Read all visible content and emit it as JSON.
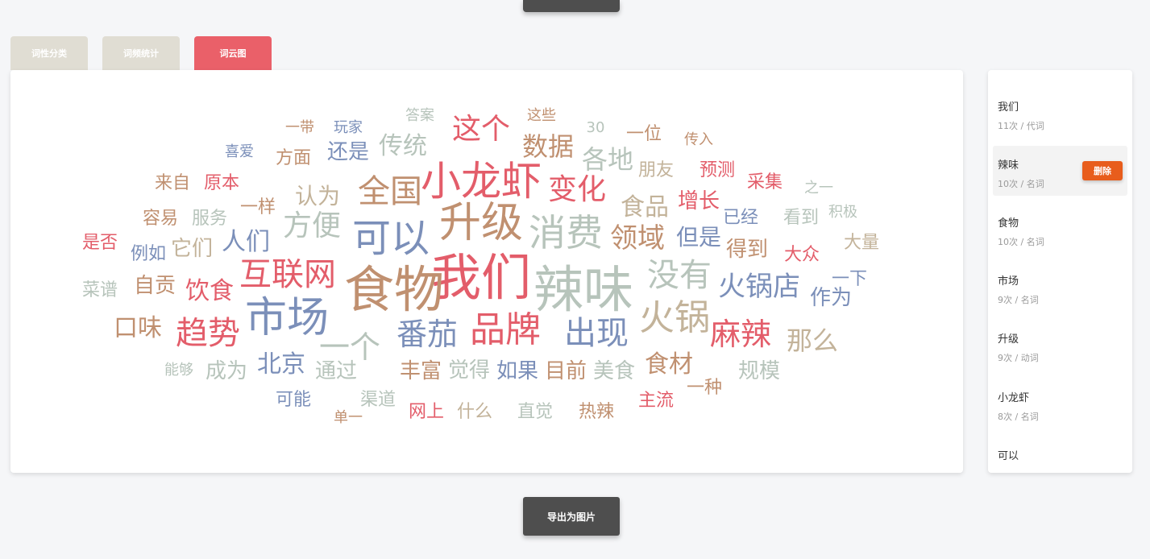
{
  "tabs": [
    {
      "label": "词性分类",
      "active": false
    },
    {
      "label": "词频统计",
      "active": false
    },
    {
      "label": "词云图",
      "active": true
    }
  ],
  "colors": {
    "red": "#e35d6a",
    "brown": "#c09070",
    "blue": "#7b8fb9",
    "sage": "#b7c4bb",
    "tan": "#c3b39a"
  },
  "cloud_words": [
    {
      "text": "我们",
      "size": 62,
      "color": "#e35d6a"
    },
    {
      "text": "食物",
      "size": 62,
      "color": "#c09070"
    },
    {
      "text": "辣味",
      "size": 62,
      "color": "#b7c4bb"
    },
    {
      "text": "升级",
      "size": 52,
      "color": "#c09070"
    },
    {
      "text": "市场",
      "size": 52,
      "color": "#7b8fb9"
    },
    {
      "text": "小龙虾",
      "size": 50,
      "color": "#e35d6a"
    },
    {
      "text": "可以",
      "size": 48,
      "color": "#7b8fb9"
    },
    {
      "text": "消费",
      "size": 46,
      "color": "#b7c4bb"
    },
    {
      "text": "品牌",
      "size": 44,
      "color": "#e35d6a"
    },
    {
      "text": "火锅",
      "size": 44,
      "color": "#c3b39a"
    },
    {
      "text": "没有",
      "size": 40,
      "color": "#b7c4bb"
    },
    {
      "text": "出现",
      "size": 40,
      "color": "#7b8fb9"
    },
    {
      "text": "全国",
      "size": 40,
      "color": "#c09070"
    },
    {
      "text": "互联网",
      "size": 40,
      "color": "#e35d6a"
    },
    {
      "text": "趋势",
      "size": 40,
      "color": "#e35d6a"
    },
    {
      "text": "番茄",
      "size": 38,
      "color": "#7b8fb9"
    },
    {
      "text": "麻辣",
      "size": 38,
      "color": "#e35d6a"
    },
    {
      "text": "一个",
      "size": 38,
      "color": "#b7c4bb"
    },
    {
      "text": "方便",
      "size": 36,
      "color": "#b7c4bb"
    },
    {
      "text": "变化",
      "size": 36,
      "color": "#e35d6a"
    },
    {
      "text": "这个",
      "size": 36,
      "color": "#e35d6a"
    },
    {
      "text": "火锅店",
      "size": 34,
      "color": "#7b8fb9"
    },
    {
      "text": "领域",
      "size": 34,
      "color": "#c09070"
    },
    {
      "text": "那么",
      "size": 32,
      "color": "#c3b39a"
    },
    {
      "text": "数据",
      "size": 32,
      "color": "#c09070"
    },
    {
      "text": "各地",
      "size": 32,
      "color": "#b7c4bb"
    },
    {
      "text": "人们",
      "size": 30,
      "color": "#7b8fb9"
    },
    {
      "text": "食品",
      "size": 30,
      "color": "#c3b39a"
    },
    {
      "text": "传统",
      "size": 30,
      "color": "#b7c4bb"
    },
    {
      "text": "食材",
      "size": 30,
      "color": "#c09070"
    },
    {
      "text": "饮食",
      "size": 30,
      "color": "#e35d6a"
    },
    {
      "text": "北京",
      "size": 30,
      "color": "#7b8fb9"
    },
    {
      "text": "口味",
      "size": 30,
      "color": "#c09070"
    },
    {
      "text": "认为",
      "size": 28,
      "color": "#c3b39a"
    },
    {
      "text": "但是",
      "size": 28,
      "color": "#7b8fb9"
    },
    {
      "text": "还是",
      "size": 26,
      "color": "#7b8fb9"
    },
    {
      "text": "增长",
      "size": 26,
      "color": "#e35d6a"
    },
    {
      "text": "它们",
      "size": 26,
      "color": "#c3b39a"
    },
    {
      "text": "作为",
      "size": 26,
      "color": "#7b8fb9"
    },
    {
      "text": "成为",
      "size": 26,
      "color": "#b7c4bb"
    },
    {
      "text": "通过",
      "size": 26,
      "color": "#b7c4bb"
    },
    {
      "text": "丰富",
      "size": 26,
      "color": "#c09070"
    },
    {
      "text": "觉得",
      "size": 26,
      "color": "#b7c4bb"
    },
    {
      "text": "如果",
      "size": 26,
      "color": "#7b8fb9"
    },
    {
      "text": "目前",
      "size": 26,
      "color": "#c09070"
    },
    {
      "text": "美食",
      "size": 26,
      "color": "#b7c4bb"
    },
    {
      "text": "规模",
      "size": 26,
      "color": "#b7c4bb"
    },
    {
      "text": "得到",
      "size": 26,
      "color": "#c09070"
    },
    {
      "text": "自贡",
      "size": 26,
      "color": "#c09070"
    },
    {
      "text": "大量",
      "size": 22,
      "color": "#c3b39a"
    },
    {
      "text": "大众",
      "size": 22,
      "color": "#e35d6a"
    },
    {
      "text": "预测",
      "size": 22,
      "color": "#e35d6a"
    },
    {
      "text": "采集",
      "size": 22,
      "color": "#e35d6a"
    },
    {
      "text": "朋友",
      "size": 22,
      "color": "#c3b39a"
    },
    {
      "text": "一位",
      "size": 22,
      "color": "#c09070"
    },
    {
      "text": "原本",
      "size": 22,
      "color": "#e35d6a"
    },
    {
      "text": "来自",
      "size": 22,
      "color": "#c09070"
    },
    {
      "text": "方面",
      "size": 22,
      "color": "#c09070"
    },
    {
      "text": "一样",
      "size": 22,
      "color": "#c09070"
    },
    {
      "text": "服务",
      "size": 22,
      "color": "#b7c4bb"
    },
    {
      "text": "容易",
      "size": 22,
      "color": "#c09070"
    },
    {
      "text": "例如",
      "size": 22,
      "color": "#7b8fb9"
    },
    {
      "text": "是否",
      "size": 22,
      "color": "#e35d6a"
    },
    {
      "text": "菜谱",
      "size": 22,
      "color": "#b7c4bb"
    },
    {
      "text": "一下",
      "size": 22,
      "color": "#7b8fb9"
    },
    {
      "text": "已经",
      "size": 22,
      "color": "#7b8fb9"
    },
    {
      "text": "看到",
      "size": 22,
      "color": "#b7c4bb"
    },
    {
      "text": "主流",
      "size": 22,
      "color": "#e35d6a"
    },
    {
      "text": "热辣",
      "size": 22,
      "color": "#c09070"
    },
    {
      "text": "直觉",
      "size": 22,
      "color": "#b7c4bb"
    },
    {
      "text": "什么",
      "size": 22,
      "color": "#c3b39a"
    },
    {
      "text": "网上",
      "size": 22,
      "color": "#e35d6a"
    },
    {
      "text": "渠道",
      "size": 22,
      "color": "#b7c4bb"
    },
    {
      "text": "可能",
      "size": 22,
      "color": "#7b8fb9"
    },
    {
      "text": "一种",
      "size": 22,
      "color": "#c09070"
    },
    {
      "text": "这些",
      "size": 18,
      "color": "#c09070"
    },
    {
      "text": "答案",
      "size": 18,
      "color": "#b7c4bb"
    },
    {
      "text": "30",
      "size": 18,
      "color": "#b7c4bb"
    },
    {
      "text": "玩家",
      "size": 18,
      "color": "#7b8fb9"
    },
    {
      "text": "一带",
      "size": 18,
      "color": "#c09070"
    },
    {
      "text": "喜爱",
      "size": 18,
      "color": "#7b8fb9"
    },
    {
      "text": "传入",
      "size": 18,
      "color": "#c09070"
    },
    {
      "text": "之一",
      "size": 18,
      "color": "#b7c4bb"
    },
    {
      "text": "积极",
      "size": 18,
      "color": "#b7c4bb"
    },
    {
      "text": "能够",
      "size": 18,
      "color": "#b7c4bb"
    },
    {
      "text": "单一",
      "size": 18,
      "color": "#c09070"
    }
  ],
  "word_list": [
    {
      "word": "我们",
      "meta": "11次 / 代词"
    },
    {
      "word": "辣味",
      "meta": "10次 / 名词"
    },
    {
      "word": "食物",
      "meta": "10次 / 名词"
    },
    {
      "word": "市场",
      "meta": "9次 / 名词"
    },
    {
      "word": "升级",
      "meta": "9次 / 动词"
    },
    {
      "word": "小龙虾",
      "meta": "8次 / 名词"
    },
    {
      "word": "可以",
      "meta": ""
    }
  ],
  "delete_label": "删除",
  "export_label": "导出为图片"
}
